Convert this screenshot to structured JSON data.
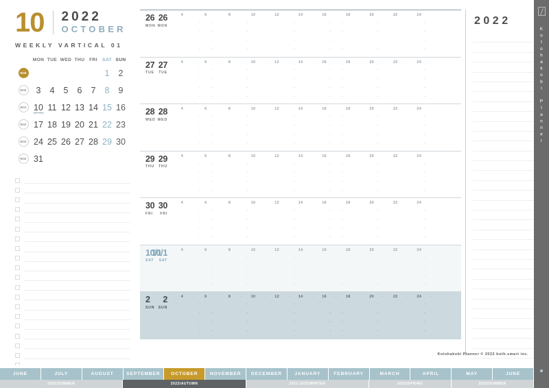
{
  "header": {
    "month_number": "10",
    "year": "2022",
    "month_name": "OCTOBER",
    "subtitle": "WEEKLY VARTICAL 01",
    "accent_gold": "#b8902e",
    "accent_blue": "#8fadbb"
  },
  "mini_calendar": {
    "weekday_headers": [
      "MON",
      "TUE",
      "WED",
      "THU",
      "FRI",
      "SAT",
      "SUN"
    ],
    "rows": [
      {
        "week": "W39",
        "current": true,
        "days": [
          "",
          "",
          "",
          "",
          "",
          "1",
          "2"
        ]
      },
      {
        "week": "W40",
        "current": false,
        "days": [
          "3",
          "4",
          "5",
          "6",
          "7",
          "8",
          "9"
        ]
      },
      {
        "week": "W41",
        "current": false,
        "days": [
          "10",
          "11",
          "12",
          "13",
          "14",
          "15",
          "16"
        ]
      },
      {
        "week": "W42",
        "current": false,
        "days": [
          "17",
          "18",
          "19",
          "20",
          "21",
          "22",
          "23"
        ]
      },
      {
        "week": "W43",
        "current": false,
        "days": [
          "24",
          "25",
          "26",
          "27",
          "28",
          "29",
          "30"
        ]
      },
      {
        "week": "W44",
        "current": false,
        "days": [
          "31",
          "",
          "",
          "",
          "",
          "",
          ""
        ]
      }
    ],
    "holiday_day": "10",
    "holiday_note": "スポーツの日"
  },
  "checklist": {
    "row_count": 20
  },
  "planner": {
    "hour_labels": [
      "4",
      "6",
      "8",
      "10",
      "12",
      "14",
      "16",
      "18",
      "20",
      "22",
      "24"
    ],
    "minor_marks": [
      "·",
      "·",
      "·",
      "·",
      "·",
      "·",
      "·",
      "·",
      "·",
      "·",
      "·",
      "·"
    ],
    "days": [
      {
        "num": "26",
        "abbr": "MON",
        "type": "weekday"
      },
      {
        "num": "27",
        "abbr": "TUE",
        "type": "weekday"
      },
      {
        "num": "28",
        "abbr": "WED",
        "type": "weekday"
      },
      {
        "num": "29",
        "abbr": "THU",
        "type": "weekday"
      },
      {
        "num": "30",
        "abbr": "FRI",
        "type": "weekday"
      },
      {
        "num": "10/1",
        "abbr": "SAT",
        "type": "sat"
      },
      {
        "num": "2",
        "abbr": "SUN",
        "type": "sun"
      }
    ]
  },
  "notes_panel": {
    "year": "2022",
    "line_count": 33
  },
  "vertical_tab": {
    "label": "Kotohakobi Planner",
    "background": "#6b6b6b"
  },
  "credit": {
    "text": "Kotohakobi Planner © 2022 both.smart inc."
  },
  "bottom_tabs": {
    "months": [
      {
        "label": "JUNE",
        "active": false
      },
      {
        "label": "JULY",
        "active": false
      },
      {
        "label": "AUGUST",
        "active": false
      },
      {
        "label": "SEPTEMBER",
        "active": false
      },
      {
        "label": "OCTOBER",
        "active": true
      },
      {
        "label": "NOVEMBER",
        "active": false
      },
      {
        "label": "DECEMBER",
        "active": false
      },
      {
        "label": "JANUARY",
        "active": false
      },
      {
        "label": "FEBRUARY",
        "active": false
      },
      {
        "label": "MARCH",
        "active": false
      },
      {
        "label": "APRIL",
        "active": false
      },
      {
        "label": "MAY",
        "active": false
      },
      {
        "label": "JUNE",
        "active": false
      }
    ],
    "seasons": [
      {
        "label": "2022/SUMMER",
        "span": 3,
        "active": false
      },
      {
        "label": "2022/AUTUMN",
        "span": 3,
        "active": true
      },
      {
        "label": "2022-2023/WINTER",
        "span": 3,
        "active": false
      },
      {
        "label": "2023/SPRING",
        "span": 2,
        "active": false
      },
      {
        "label": "2023/SUMMER",
        "span": 2,
        "active": false
      }
    ]
  }
}
